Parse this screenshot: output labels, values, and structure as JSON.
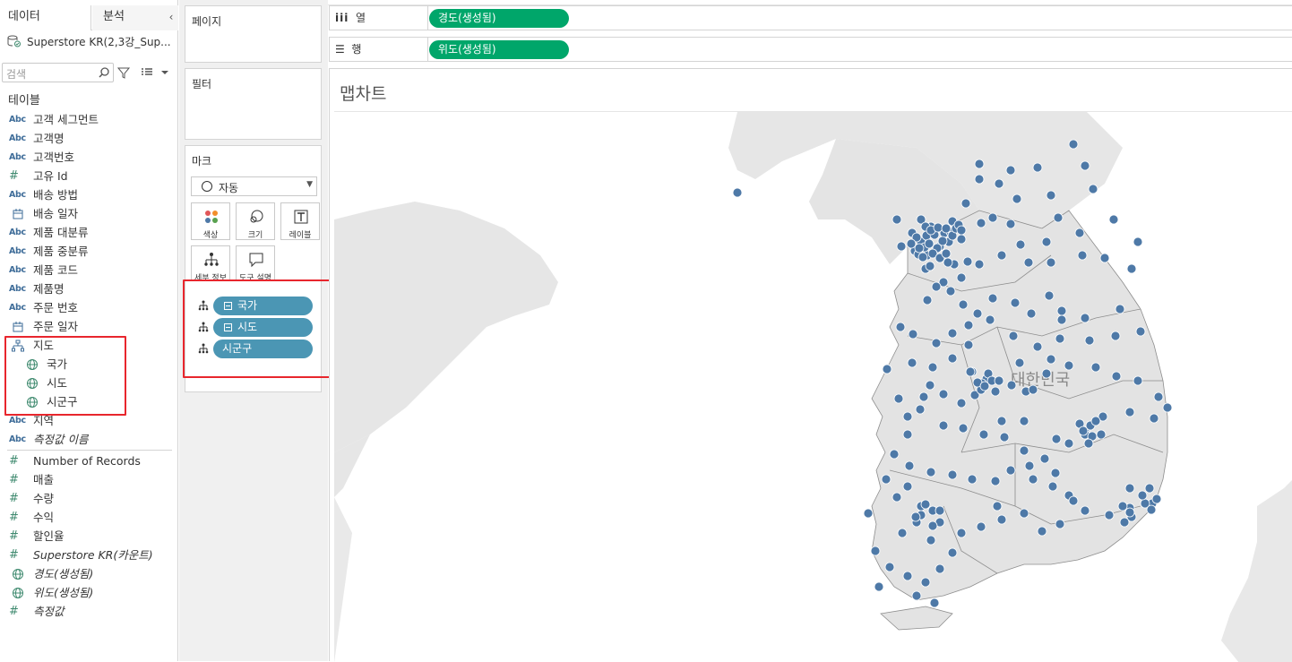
{
  "tabs": {
    "data": "데이터",
    "analysis": "분석",
    "collapse": "‹"
  },
  "datasource": "Superstore KR(2,3강_Sup...",
  "search": {
    "placeholder": "검색"
  },
  "tables_title": "테이블",
  "fields": [
    {
      "type": "abc",
      "label": "고객 세그먼트"
    },
    {
      "type": "abc",
      "label": "고객명"
    },
    {
      "type": "abc",
      "label": "고객번호"
    },
    {
      "type": "hash",
      "label": "고유 Id"
    },
    {
      "type": "abc",
      "label": "배송 방법"
    },
    {
      "type": "cal",
      "label": "배송 일자"
    },
    {
      "type": "abc",
      "label": "제품 대분류"
    },
    {
      "type": "abc",
      "label": "제품 중분류"
    },
    {
      "type": "abc",
      "label": "제품 코드"
    },
    {
      "type": "abc",
      "label": "제품명"
    },
    {
      "type": "abc",
      "label": "주문 번호"
    },
    {
      "type": "cal",
      "label": "주문 일자"
    },
    {
      "type": "hier",
      "label": "지도"
    },
    {
      "type": "globe",
      "label": "국가",
      "sub": true
    },
    {
      "type": "globe",
      "label": "시도",
      "sub": true
    },
    {
      "type": "globe",
      "label": "시군구",
      "sub": true
    },
    {
      "type": "abc",
      "label": "지역"
    },
    {
      "type": "abc",
      "label": "측정값 이름",
      "italic": true
    }
  ],
  "measures": [
    {
      "type": "hash",
      "label": "Number of Records"
    },
    {
      "type": "hash",
      "label": "매출"
    },
    {
      "type": "hash",
      "label": "수량"
    },
    {
      "type": "hash",
      "label": "수익"
    },
    {
      "type": "hash",
      "label": "할인율"
    },
    {
      "type": "hash",
      "label": "Superstore KR(카운트)",
      "italic": true
    },
    {
      "type": "globe",
      "label": "경도(생성됨)",
      "italic": true
    },
    {
      "type": "globe",
      "label": "위도(생성됨)",
      "italic": true
    },
    {
      "type": "hash",
      "label": "측정값",
      "italic": true
    }
  ],
  "icons": {
    "abc": "Abc",
    "hash": "#",
    "cal": "calendar-icon",
    "globe": "globe-icon",
    "hier": "hierarchy-icon"
  },
  "cards": {
    "pages": "페이지",
    "filters": "필터",
    "marks": "마크",
    "mark_type": "자동",
    "buttons": {
      "color": "색상",
      "size": "크기",
      "label": "레이블",
      "detail": "세부 정보",
      "tooltip": "도구 설명"
    }
  },
  "mark_pills": [
    "국가",
    "시도",
    "시군구"
  ],
  "shelves": {
    "columns_label": "열",
    "rows_label": "행",
    "columns_pill": "경도(생성됨)",
    "rows_pill": "위도(생성됨)"
  },
  "view": {
    "title": "맵차트",
    "map_label": "대한민국"
  },
  "colors": {
    "pill_green": "#00a66a",
    "pill_blue": "#4b96b4",
    "mark": "#4e79a7",
    "highlight": "#e8262d"
  },
  "map_points": {
    "description_count": 250,
    "cluster": [
      "Seoul",
      "Busan",
      "Daegu",
      "Daejeon",
      "Gwangju",
      "Ulsan",
      "Incheon"
    ]
  }
}
